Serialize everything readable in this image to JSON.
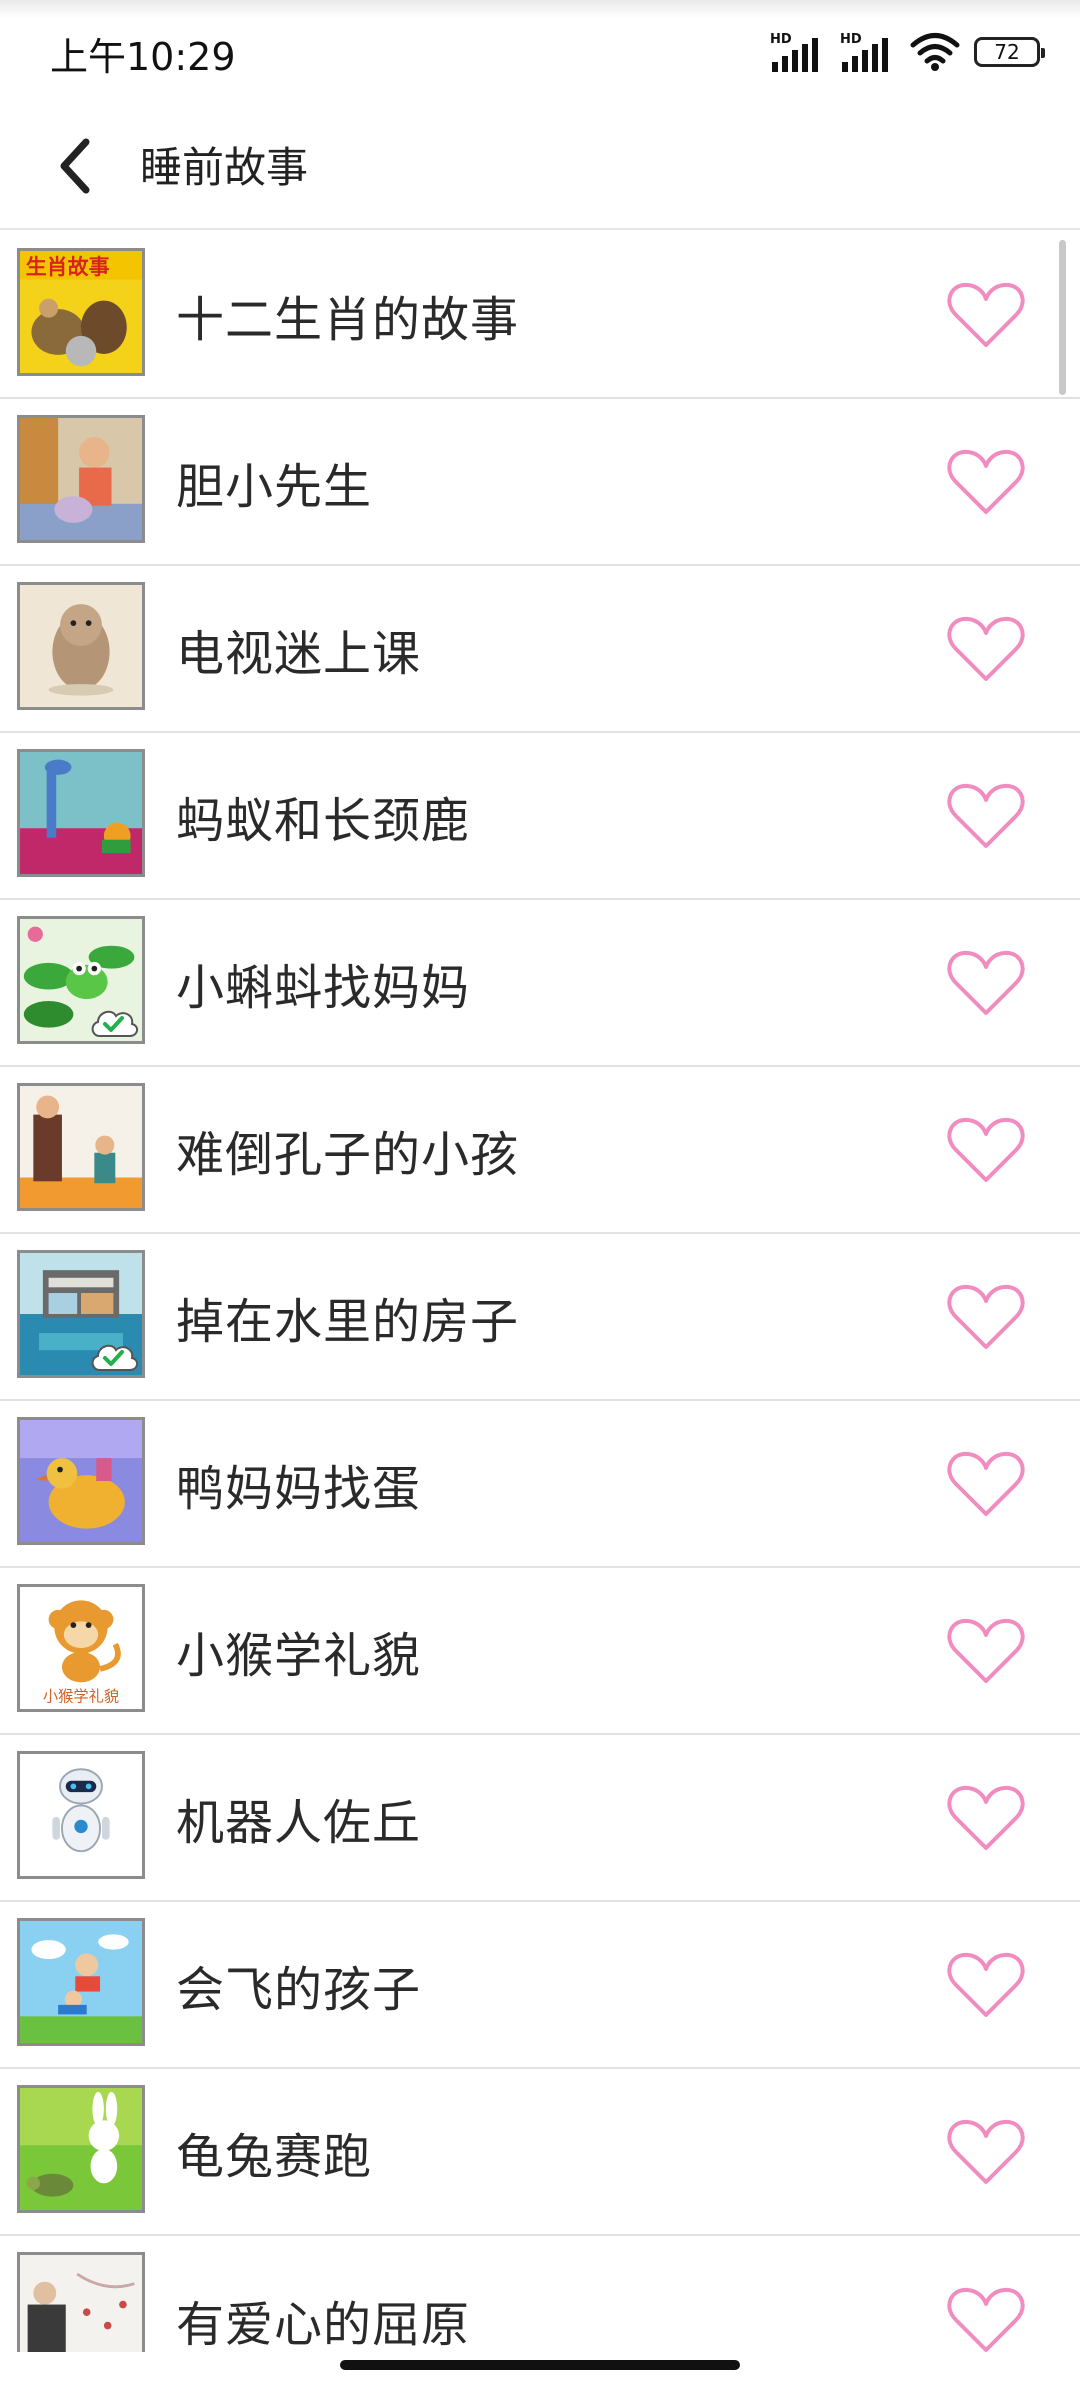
{
  "status_bar": {
    "time": "上午10:29",
    "hd_label_1": "HD",
    "hd_label_2": "HD",
    "battery": "72"
  },
  "app_bar": {
    "title": "睡前故事",
    "back_icon": "chevron-left-icon"
  },
  "colors": {
    "heart": "#f08cc0",
    "divider": "#e2e2e2",
    "title_text": "#2a2a2a"
  },
  "stories": [
    {
      "title": "十二生肖的故事",
      "thumb_icon": "zodiac-cover-thumbnail",
      "downloaded": false
    },
    {
      "title": "胆小先生",
      "thumb_icon": "timid-man-thumbnail",
      "downloaded": false
    },
    {
      "title": "电视迷上课",
      "thumb_icon": "hamster-thumbnail",
      "downloaded": false
    },
    {
      "title": "蚂蚁和长颈鹿",
      "thumb_icon": "giraffe-thumbnail",
      "downloaded": false
    },
    {
      "title": "小蝌蚪找妈妈",
      "thumb_icon": "frog-thumbnail",
      "downloaded": true
    },
    {
      "title": "难倒孔子的小孩",
      "thumb_icon": "confucius-thumbnail",
      "downloaded": false
    },
    {
      "title": "掉在水里的房子",
      "thumb_icon": "house-in-water-thumbnail",
      "downloaded": true
    },
    {
      "title": "鸭妈妈找蛋",
      "thumb_icon": "duck-thumbnail",
      "downloaded": false
    },
    {
      "title": "小猴学礼貌",
      "thumb_icon": "monkey-thumbnail",
      "downloaded": false,
      "thumb_caption": "小猴学礼貌"
    },
    {
      "title": "机器人佐丘",
      "thumb_icon": "robot-thumbnail",
      "downloaded": false
    },
    {
      "title": "会飞的孩子",
      "thumb_icon": "flying-kids-thumbnail",
      "downloaded": false
    },
    {
      "title": "龟兔赛跑",
      "thumb_icon": "rabbit-turtle-thumbnail",
      "downloaded": false
    },
    {
      "title": "有爱心的屈原",
      "thumb_icon": "qu-yuan-thumbnail",
      "downloaded": false
    }
  ]
}
